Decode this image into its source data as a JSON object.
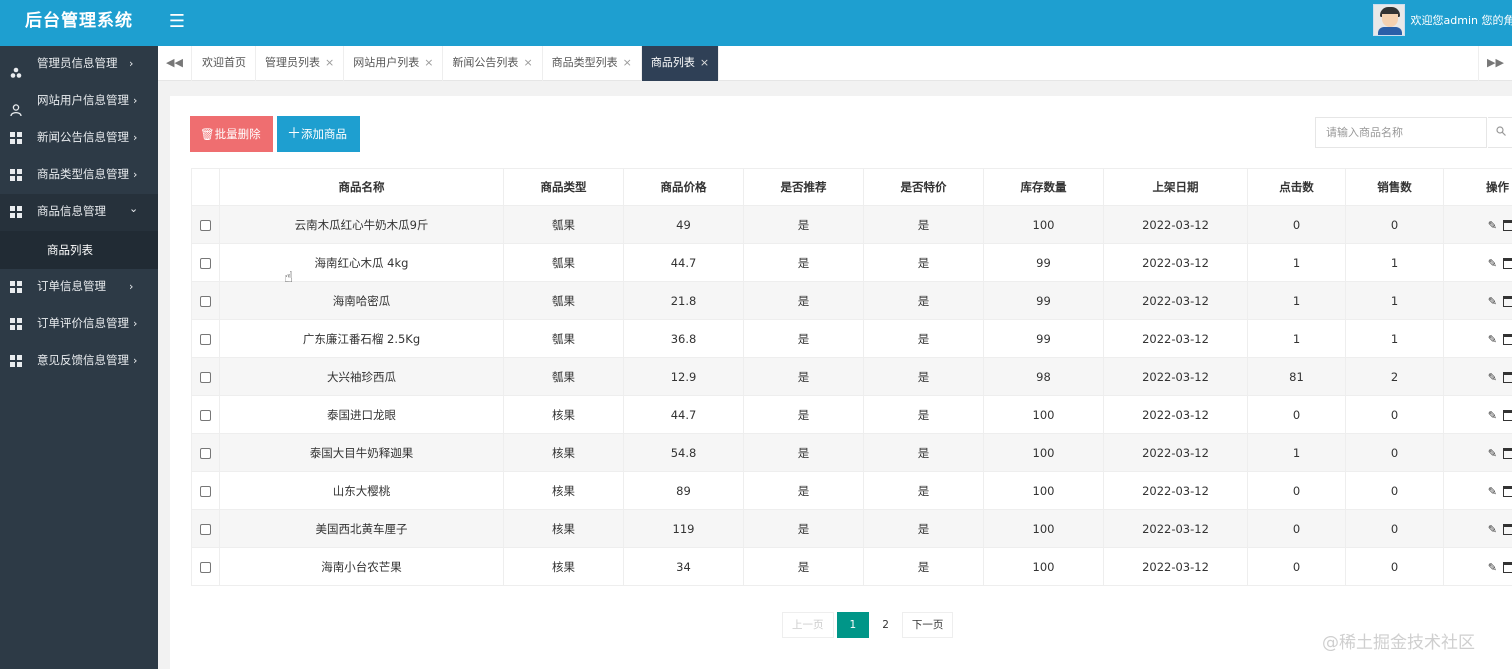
{
  "app": {
    "title": "后台管理系统",
    "menu_toggle_icon": "hamburger-icon"
  },
  "user": {
    "welcome": "欢迎您admin 您的角"
  },
  "sidebar": {
    "items": [
      {
        "label": "管理员信息管理",
        "icon": "users-icon",
        "arrow": "›"
      },
      {
        "label": "网站用户信息管理",
        "icon": "user-icon",
        "arrow": "›"
      },
      {
        "label": "新闻公告信息管理",
        "icon": "grid-icon",
        "arrow": "›"
      },
      {
        "label": "商品类型信息管理",
        "icon": "grid-icon",
        "arrow": "›"
      },
      {
        "label": "商品信息管理",
        "icon": "grid-icon",
        "arrow": "⌄",
        "expanded": true,
        "children": [
          {
            "label": "商品列表"
          }
        ]
      },
      {
        "label": "订单信息管理",
        "icon": "grid-icon",
        "arrow": "›"
      },
      {
        "label": "订单评价信息管理",
        "icon": "grid-icon",
        "arrow": "›"
      },
      {
        "label": "意见反馈信息管理",
        "icon": "grid-icon",
        "arrow": "›"
      }
    ]
  },
  "tabs": {
    "items": [
      {
        "label": "欢迎首页",
        "closable": false
      },
      {
        "label": "管理员列表",
        "closable": true
      },
      {
        "label": "网站用户列表",
        "closable": true
      },
      {
        "label": "新闻公告列表",
        "closable": true
      },
      {
        "label": "商品类型列表",
        "closable": true
      },
      {
        "label": "商品列表",
        "closable": true,
        "active": true
      }
    ],
    "close_glyph": "×"
  },
  "toolbar": {
    "batch_delete_label": "批量删除",
    "add_label": "添加商品"
  },
  "search": {
    "placeholder": "请输入商品名称",
    "value": ""
  },
  "table": {
    "columns": [
      "",
      "商品名称",
      "商品类型",
      "商品价格",
      "是否推荐",
      "是否特价",
      "库存数量",
      "上架日期",
      "点击数",
      "销售数",
      "操作"
    ],
    "rows": [
      [
        "云南木瓜红心牛奶木瓜9斤",
        "瓠果",
        "49",
        "是",
        "是",
        "100",
        "2022-03-12",
        "0",
        "0"
      ],
      [
        "海南红心木瓜 4kg",
        "瓠果",
        "44.7",
        "是",
        "是",
        "99",
        "2022-03-12",
        "1",
        "1"
      ],
      [
        "海南哈密瓜",
        "瓠果",
        "21.8",
        "是",
        "是",
        "99",
        "2022-03-12",
        "1",
        "1"
      ],
      [
        "广东廉江番石榴 2.5Kg",
        "瓠果",
        "36.8",
        "是",
        "是",
        "99",
        "2022-03-12",
        "1",
        "1"
      ],
      [
        "大兴袖珍西瓜",
        "瓠果",
        "12.9",
        "是",
        "是",
        "98",
        "2022-03-12",
        "81",
        "2"
      ],
      [
        "泰国进口龙眼",
        "核果",
        "44.7",
        "是",
        "是",
        "100",
        "2022-03-12",
        "0",
        "0"
      ],
      [
        "泰国大目牛奶释迦果",
        "核果",
        "54.8",
        "是",
        "是",
        "100",
        "2022-03-12",
        "1",
        "0"
      ],
      [
        "山东大樱桃",
        "核果",
        "89",
        "是",
        "是",
        "100",
        "2022-03-12",
        "0",
        "0"
      ],
      [
        "美国西北黄车厘子",
        "核果",
        "119",
        "是",
        "是",
        "100",
        "2022-03-12",
        "0",
        "0"
      ],
      [
        "海南小台农芒果",
        "核果",
        "34",
        "是",
        "是",
        "100",
        "2022-03-12",
        "0",
        "0"
      ]
    ]
  },
  "pagination": {
    "prev": "上一页",
    "pages": [
      "1",
      "2"
    ],
    "current": "1",
    "next": "下一页"
  },
  "watermark": "@稀土掘金技术社区",
  "colors": {
    "header": "#1e9fd0",
    "sidebar": "#2d3a46",
    "delete": "#ef6e70",
    "add": "#1e9fd0",
    "page_current": "#009688",
    "tab_active": "#2f4056"
  }
}
